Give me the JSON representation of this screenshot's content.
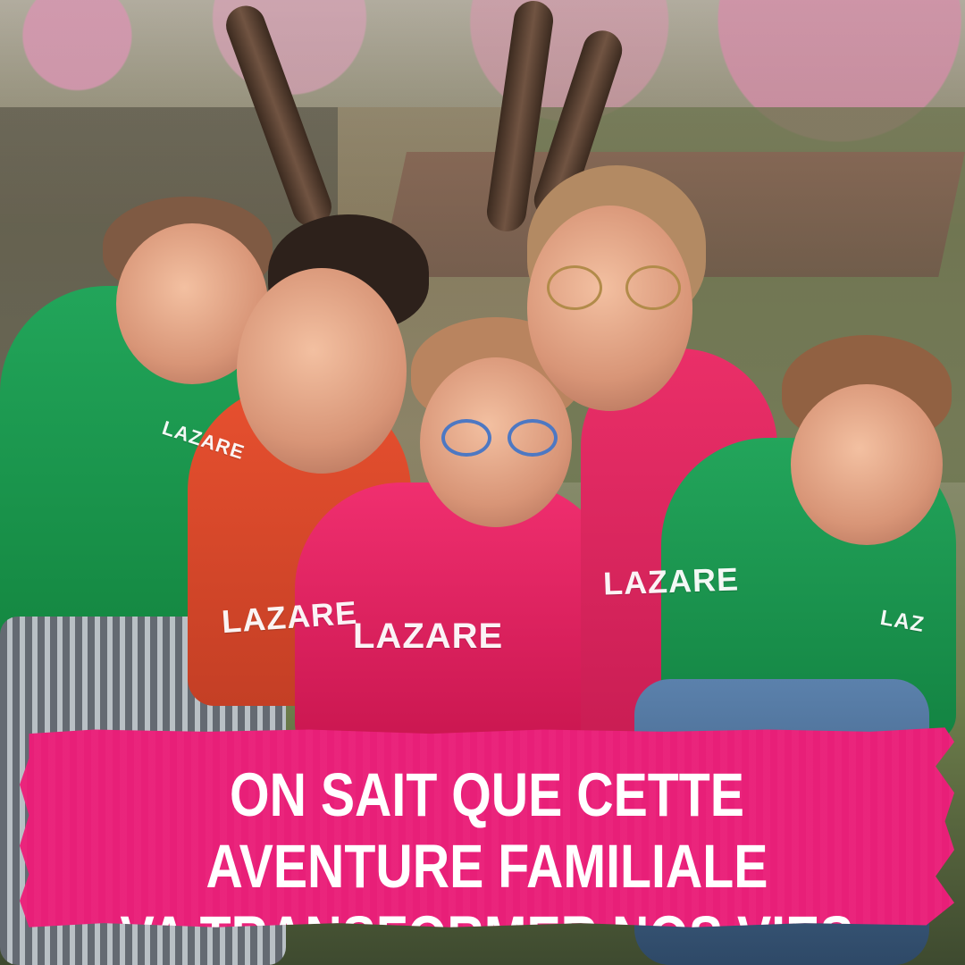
{
  "photo": {
    "hoodie_text_left": "LAZARE",
    "hoodie_text_dad": "LAZARE",
    "hoodie_text_girl": "LAZARE",
    "hoodie_text_mom": "LAZARE",
    "hoodie_text_baby": "LAZ"
  },
  "banner": {
    "line1": "ON SAIT QUE CETTE AVENTURE FAMILIALE",
    "line2": "VA TRANSFORMER NOS VIES",
    "background_color": "#ea1f79",
    "text_color": "#ffffff"
  }
}
